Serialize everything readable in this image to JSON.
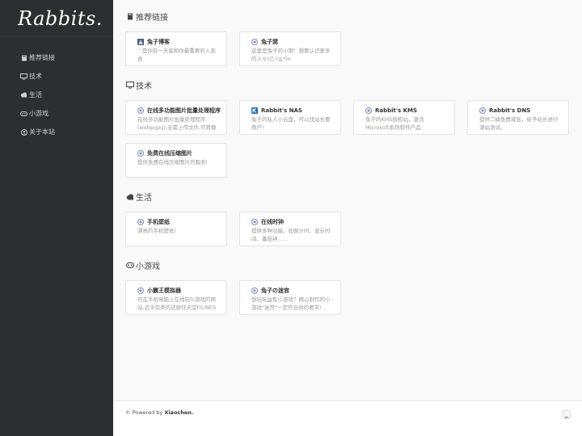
{
  "logo": {
    "text": "Rabbits."
  },
  "nav": [
    {
      "label": "推荐链接",
      "icon": "book-icon"
    },
    {
      "label": "技术",
      "icon": "monitor-icon"
    },
    {
      "label": "生活",
      "icon": "cloud-icon"
    },
    {
      "label": "小游戏",
      "icon": "gamepad-icon"
    },
    {
      "label": "关于本站",
      "icon": "user-icon"
    }
  ],
  "sections": {
    "recommend": {
      "title": "推荐链接",
      "cards": [
        {
          "title": "兔子博客",
          "desc": "♡是你有一天能和你最重要的人奔逐"
        },
        {
          "title": "兔子窝",
          "desc": "这里是兔子的小窝！想要认识更多的人々(乙▽≦*)o"
        }
      ]
    },
    "tech": {
      "title": "技术",
      "cards": [
        {
          "title": "在线多功能图片批量处理程序",
          "desc": "在线多功能图片批量处理程序(webp/jpg),无需上传文件,可转换"
        },
        {
          "title": "Rabbit's NAS",
          "desc": "兔子的私人小云盘，可以找站长要用户!"
        },
        {
          "title": "Rabbit's KMS",
          "desc": "兔子的KMS授权站，激活Microsoft系列软件产品"
        },
        {
          "title": "Rabbit's DNS",
          "desc": "提供二级免费域名，给予站长进行源站测试。"
        },
        {
          "title": "免费在线压缩图片",
          "desc": "提供免费在线压缩图片的服务!"
        }
      ]
    },
    "life": {
      "title": "生活",
      "cards": [
        {
          "title": "手机壁纸",
          "desc": "漂亮的手机壁纸!"
        },
        {
          "title": "在线时钟",
          "desc": "提供多种功能。如倒计时、显示时间、番茄钟……"
        }
      ]
    },
    "games": {
      "title": "小游戏",
      "cards": [
        {
          "title": "小霸王模拟器",
          "desc": "可在手机电脑上在线玩fc游戏的网站,近乎完美的还原任天堂FC/NES游戏机"
        },
        {
          "title": "兔子の迷宫",
          "desc": "想玩玩益智小游戏？精心制作的小游戏\"迷宫\"一定符合你的要求!"
        }
      ]
    }
  },
  "footer": {
    "prefix": "© Powered by ",
    "author": "Xiaochen."
  },
  "colors": {
    "sidebar": "#2c2e2f",
    "background": "#f9f9f9",
    "accent": "#1e6fb8"
  }
}
